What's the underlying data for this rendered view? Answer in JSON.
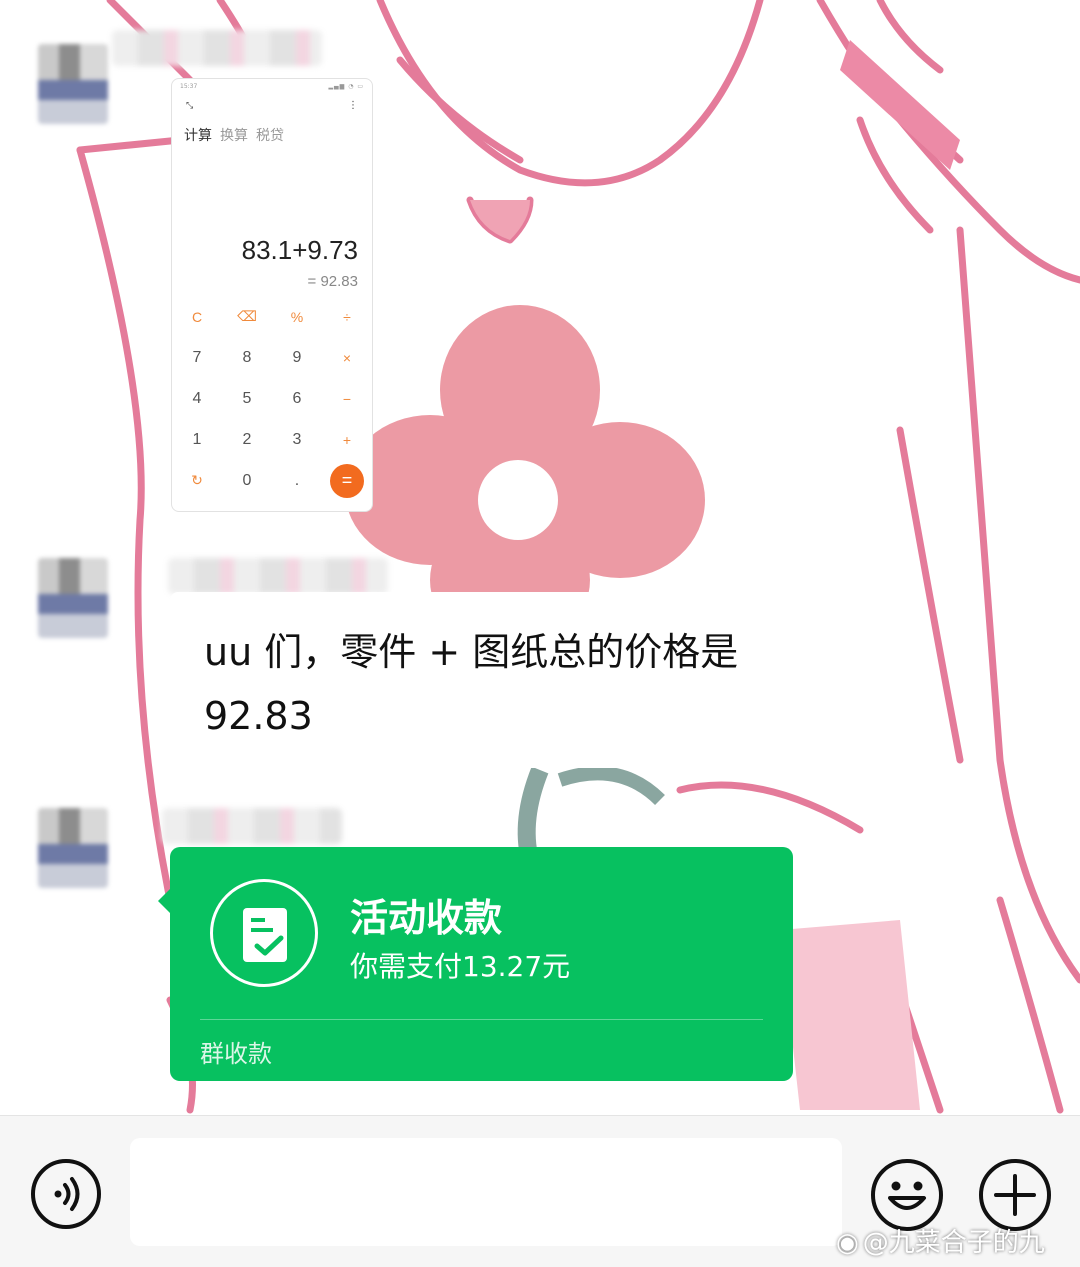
{
  "calculator": {
    "status_time": "15:37",
    "tabs": [
      "计算",
      "换算",
      "税贷"
    ],
    "expression": "83.1+9.73",
    "result": "= 92.83",
    "keys": [
      [
        "C",
        "⌫",
        "%",
        "÷"
      ],
      [
        "7",
        "8",
        "9",
        "×"
      ],
      [
        "4",
        "5",
        "6",
        "−"
      ],
      [
        "1",
        "2",
        "3",
        "+"
      ],
      [
        "↻",
        "0",
        ".",
        "="
      ]
    ]
  },
  "messages": {
    "text": "uu 们，零件 + 图纸总的价格是 92.83"
  },
  "payment_card": {
    "title": "活动收款",
    "subtitle": "你需支付13.27元",
    "footer": "群收款"
  },
  "input_bar": {
    "placeholder": ""
  },
  "watermark": "@九菜合子的九",
  "colors": {
    "payment_green": "#07c160",
    "calc_accent": "#f26b1f",
    "wallpaper_pink": "#e47b9a",
    "flower_pink": "#ec9aa4"
  },
  "icons": [
    "voice-icon",
    "emoji-icon",
    "plus-icon",
    "receipt-check-icon",
    "weibo-logo-icon"
  ]
}
